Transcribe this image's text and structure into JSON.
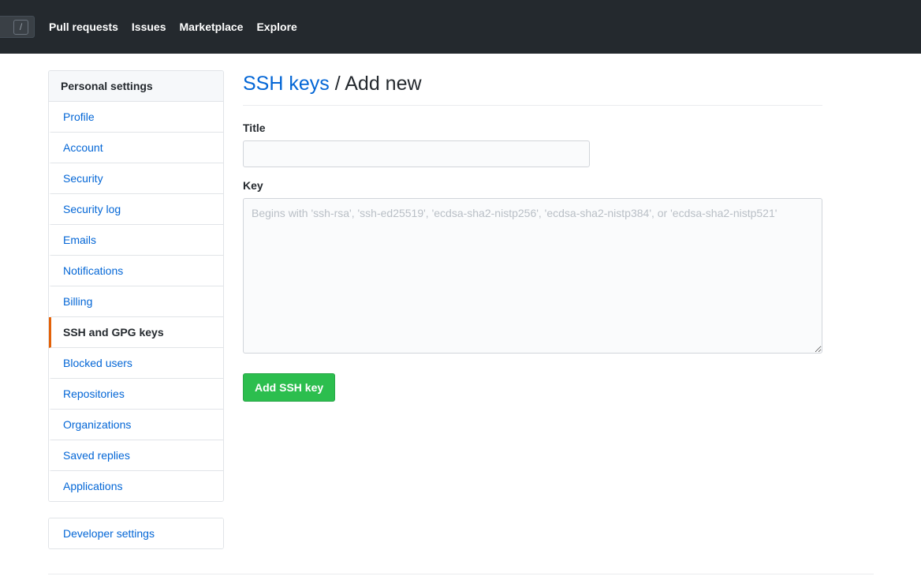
{
  "header": {
    "search": {
      "placeholder": "",
      "shortcut_badge": "/"
    },
    "nav": [
      {
        "label": "Pull requests"
      },
      {
        "label": "Issues"
      },
      {
        "label": "Marketplace"
      },
      {
        "label": "Explore"
      }
    ]
  },
  "sidebar": {
    "heading": "Personal settings",
    "items": [
      {
        "label": "Profile",
        "selected": false
      },
      {
        "label": "Account",
        "selected": false
      },
      {
        "label": "Security",
        "selected": false
      },
      {
        "label": "Security log",
        "selected": false
      },
      {
        "label": "Emails",
        "selected": false
      },
      {
        "label": "Notifications",
        "selected": false
      },
      {
        "label": "Billing",
        "selected": false
      },
      {
        "label": "SSH and GPG keys",
        "selected": true
      },
      {
        "label": "Blocked users",
        "selected": false
      },
      {
        "label": "Repositories",
        "selected": false
      },
      {
        "label": "Organizations",
        "selected": false
      },
      {
        "label": "Saved replies",
        "selected": false
      },
      {
        "label": "Applications",
        "selected": false
      }
    ],
    "developer": [
      {
        "label": "Developer settings"
      }
    ]
  },
  "main": {
    "breadcrumb_link": "SSH keys",
    "breadcrumb_separator": "/",
    "breadcrumb_current": "Add new",
    "fields": {
      "title": {
        "label": "Title",
        "value": "",
        "placeholder": ""
      },
      "key": {
        "label": "Key",
        "value": "",
        "placeholder": "Begins with 'ssh-rsa', 'ssh-ed25519', 'ecdsa-sha2-nistp256', 'ecdsa-sha2-nistp384', or 'ecdsa-sha2-nistp521'"
      }
    },
    "submit_label": "Add SSH key"
  },
  "colors": {
    "header_bg": "#24292e",
    "link": "#0366d6",
    "accent_selected": "#e36209",
    "button_green": "#2cbe4e",
    "border": "#e1e4e8"
  }
}
